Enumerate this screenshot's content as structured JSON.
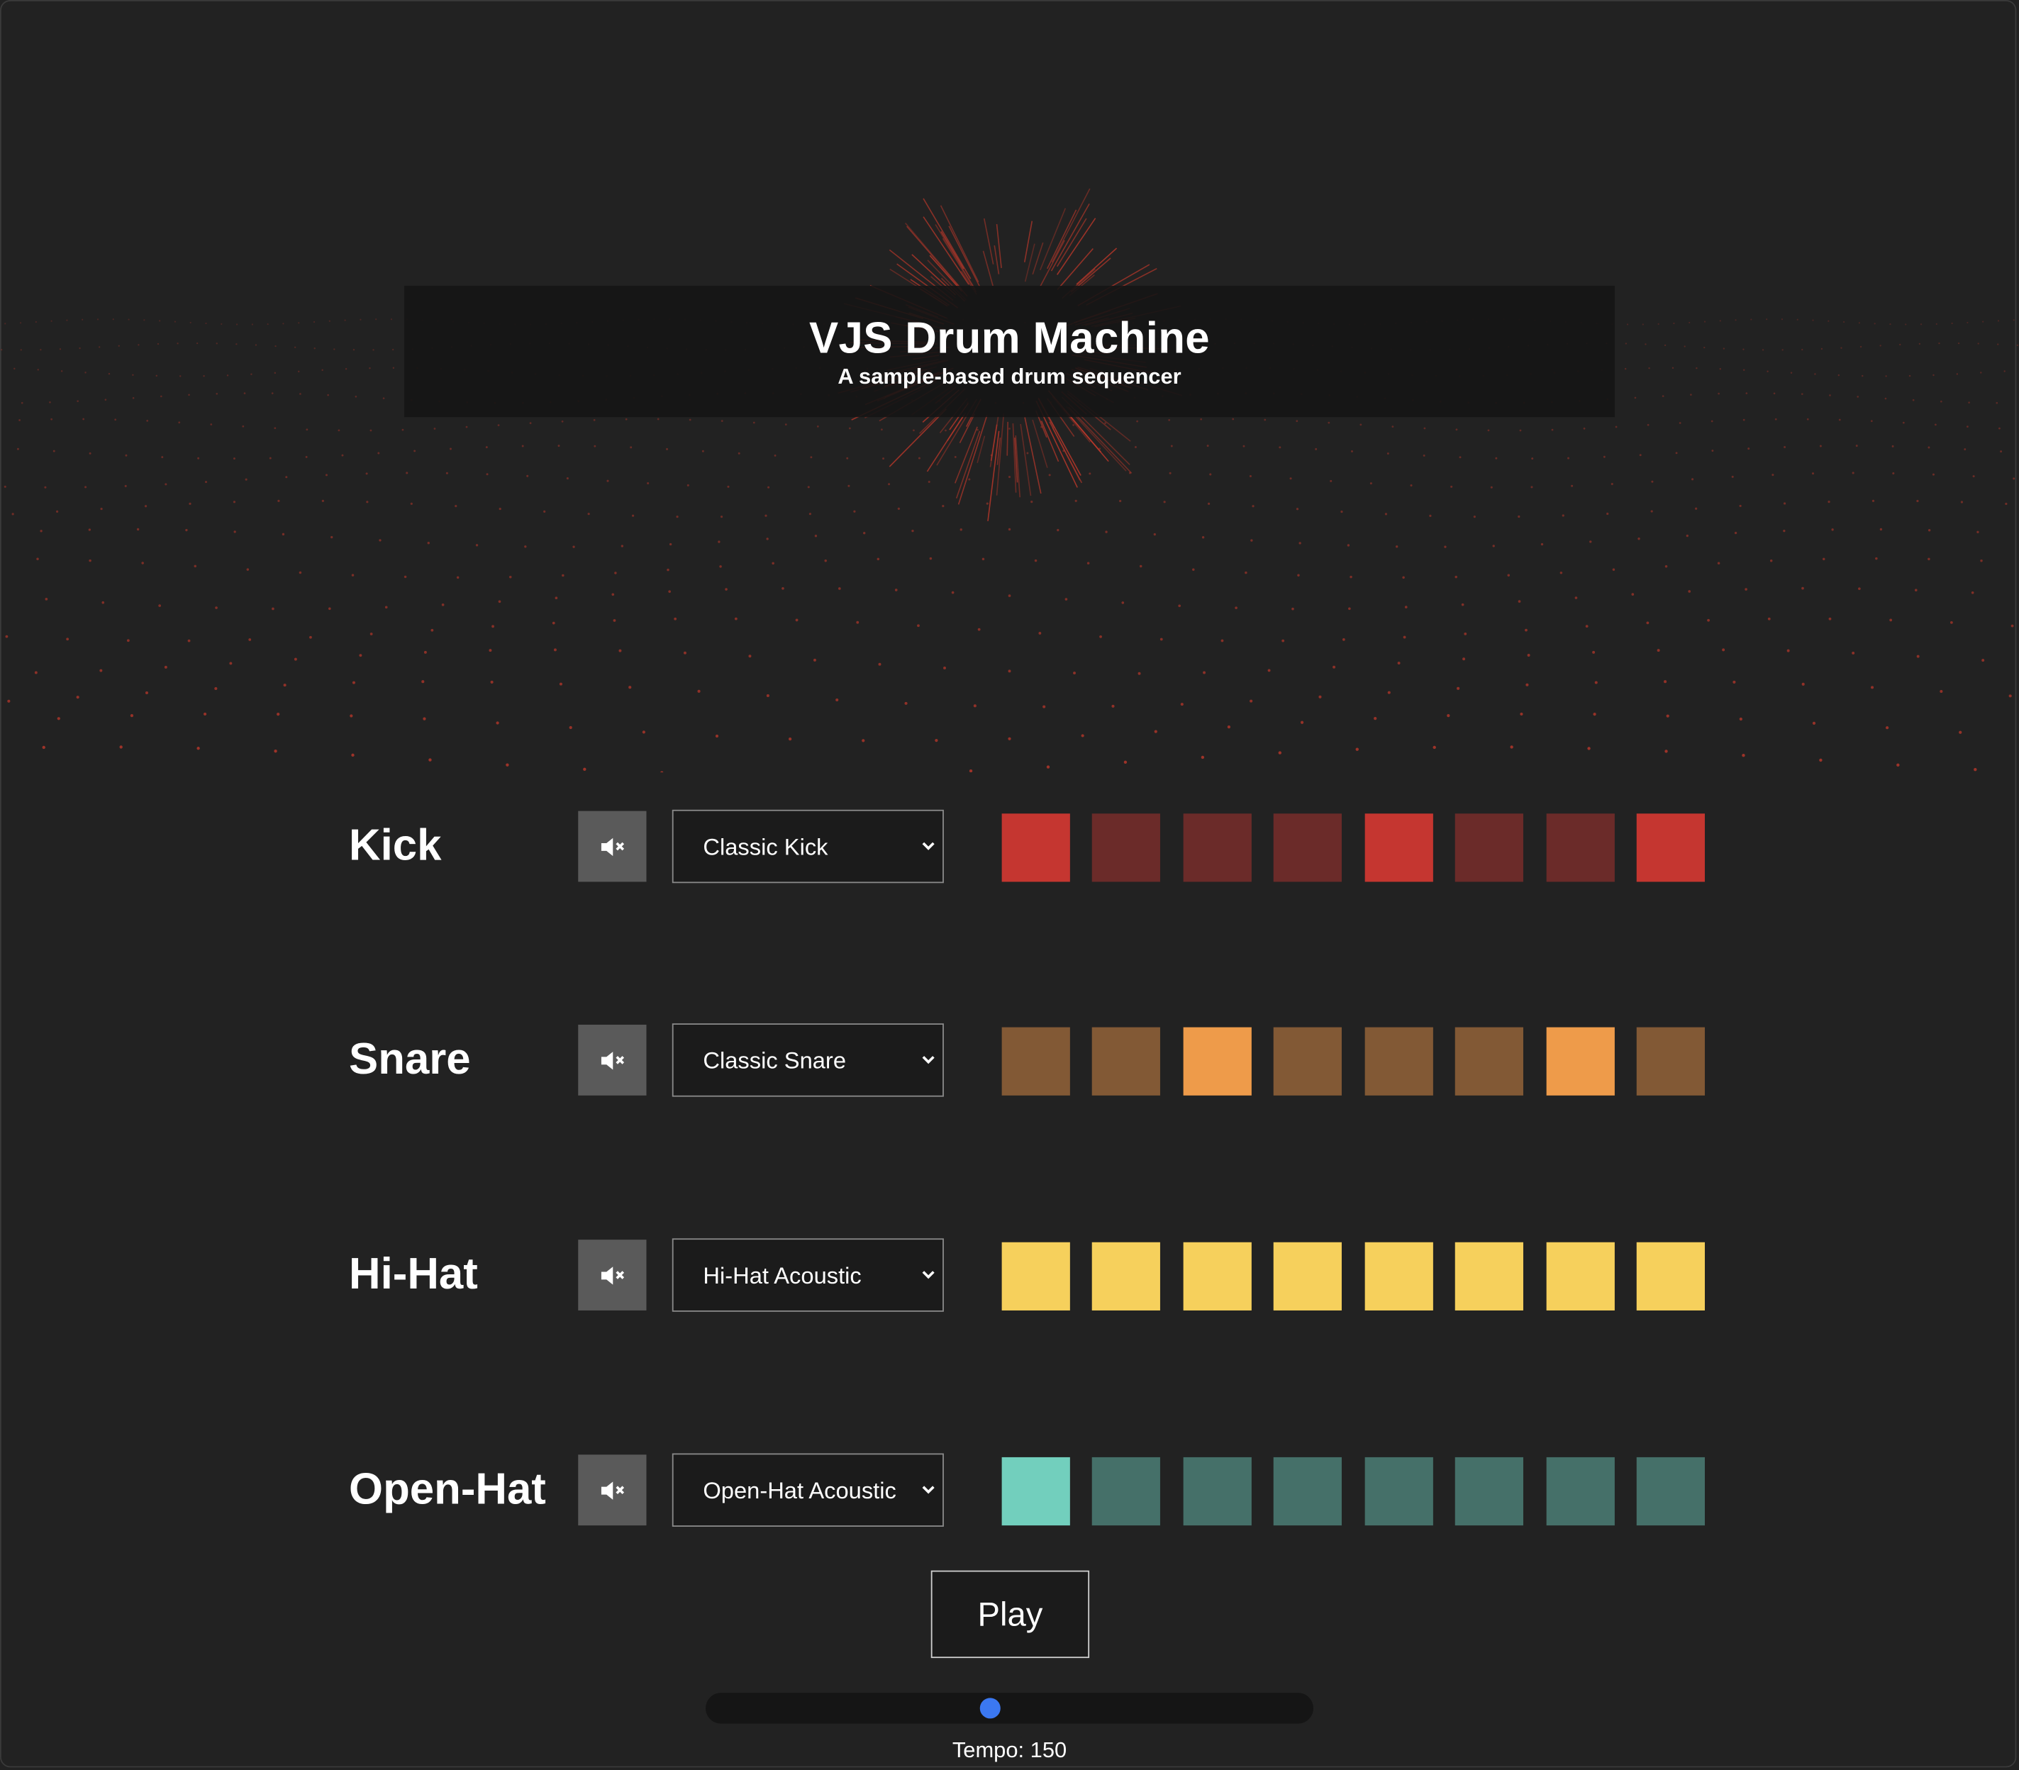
{
  "header": {
    "title": "VJS Drum Machine",
    "subtitle": "A sample-based drum sequencer"
  },
  "colors": {
    "background": "#222222",
    "kick_active": "#c53630",
    "kick_inactive": "#6b2b29",
    "snare_active": "#ee9b4a",
    "snare_inactive": "#825935",
    "hihat_active": "#f6d05c",
    "hihat_inactive": "#f6d05c",
    "openhat_active": "#72cfbd",
    "openhat_inactive": "#457069",
    "visualizer_accent": "#c0392b",
    "slider_thumb": "#3b78f2"
  },
  "tracks": [
    {
      "name": "Kick",
      "mute_icon": "speaker-mute-icon",
      "sample": "Classic Kick",
      "color_key": "kick",
      "steps": [
        true,
        false,
        false,
        false,
        true,
        false,
        false,
        true
      ]
    },
    {
      "name": "Snare",
      "mute_icon": "speaker-mute-icon",
      "sample": "Classic Snare",
      "color_key": "snare",
      "steps": [
        false,
        false,
        true,
        false,
        false,
        false,
        true,
        false
      ]
    },
    {
      "name": "Hi-Hat",
      "mute_icon": "speaker-mute-icon",
      "sample": "Hi-Hat Acoustic",
      "color_key": "hihat",
      "steps": [
        true,
        true,
        true,
        true,
        true,
        true,
        true,
        true
      ]
    },
    {
      "name": "Open-Hat",
      "mute_icon": "speaker-mute-icon",
      "sample": "Open-Hat Acoustic",
      "color_key": "openhat",
      "steps": [
        true,
        false,
        false,
        false,
        false,
        false,
        false,
        false
      ]
    }
  ],
  "transport": {
    "play_label": "Play",
    "tempo_label": "Tempo: 150",
    "tempo_value": 150,
    "tempo_slider_fraction": 0.468
  }
}
